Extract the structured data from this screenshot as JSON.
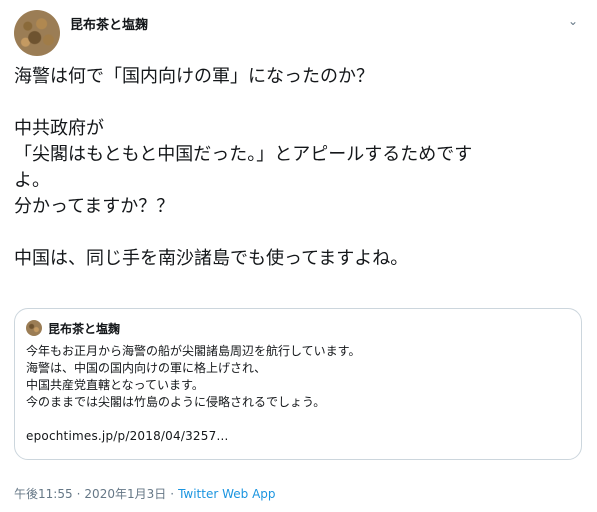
{
  "author": {
    "name": "昆布茶と塩麹",
    "avatar_icon": "avatar-icon"
  },
  "menu": {
    "caret_glyph": "⌄",
    "icon": "chevron-down-icon"
  },
  "tweet": {
    "lines": [
      "海警は何で「国内向けの軍」になったのか？",
      "",
      "中共政府が",
      "「尖閣はもともと中国だった。」とアピールするためです",
      "よ。",
      "分かってますか？？",
      "",
      "中国は、同じ手を南沙諸島でも使ってますよね。"
    ]
  },
  "quote": {
    "author_name": "昆布茶と塩麹",
    "lines": [
      "今年もお正月から海警の船が尖閣諸島周辺を航行しています。",
      "海警は、中国の国内向けの軍に格上げされ、",
      "中国共産党直轄となっています。",
      "今のままでは尖閣は竹島のように侵略されるでしょう。"
    ],
    "link": "epochtimes.jp/p/2018/04/3257…"
  },
  "meta": {
    "time": "午後11:55",
    "separator1": "·",
    "date": "2020年1月3日",
    "separator2": "·",
    "source": "Twitter Web App"
  },
  "colors": {
    "text": "#14171a",
    "secondary": "#657786",
    "link": "#1b95e0",
    "border": "#ccd6dd"
  }
}
